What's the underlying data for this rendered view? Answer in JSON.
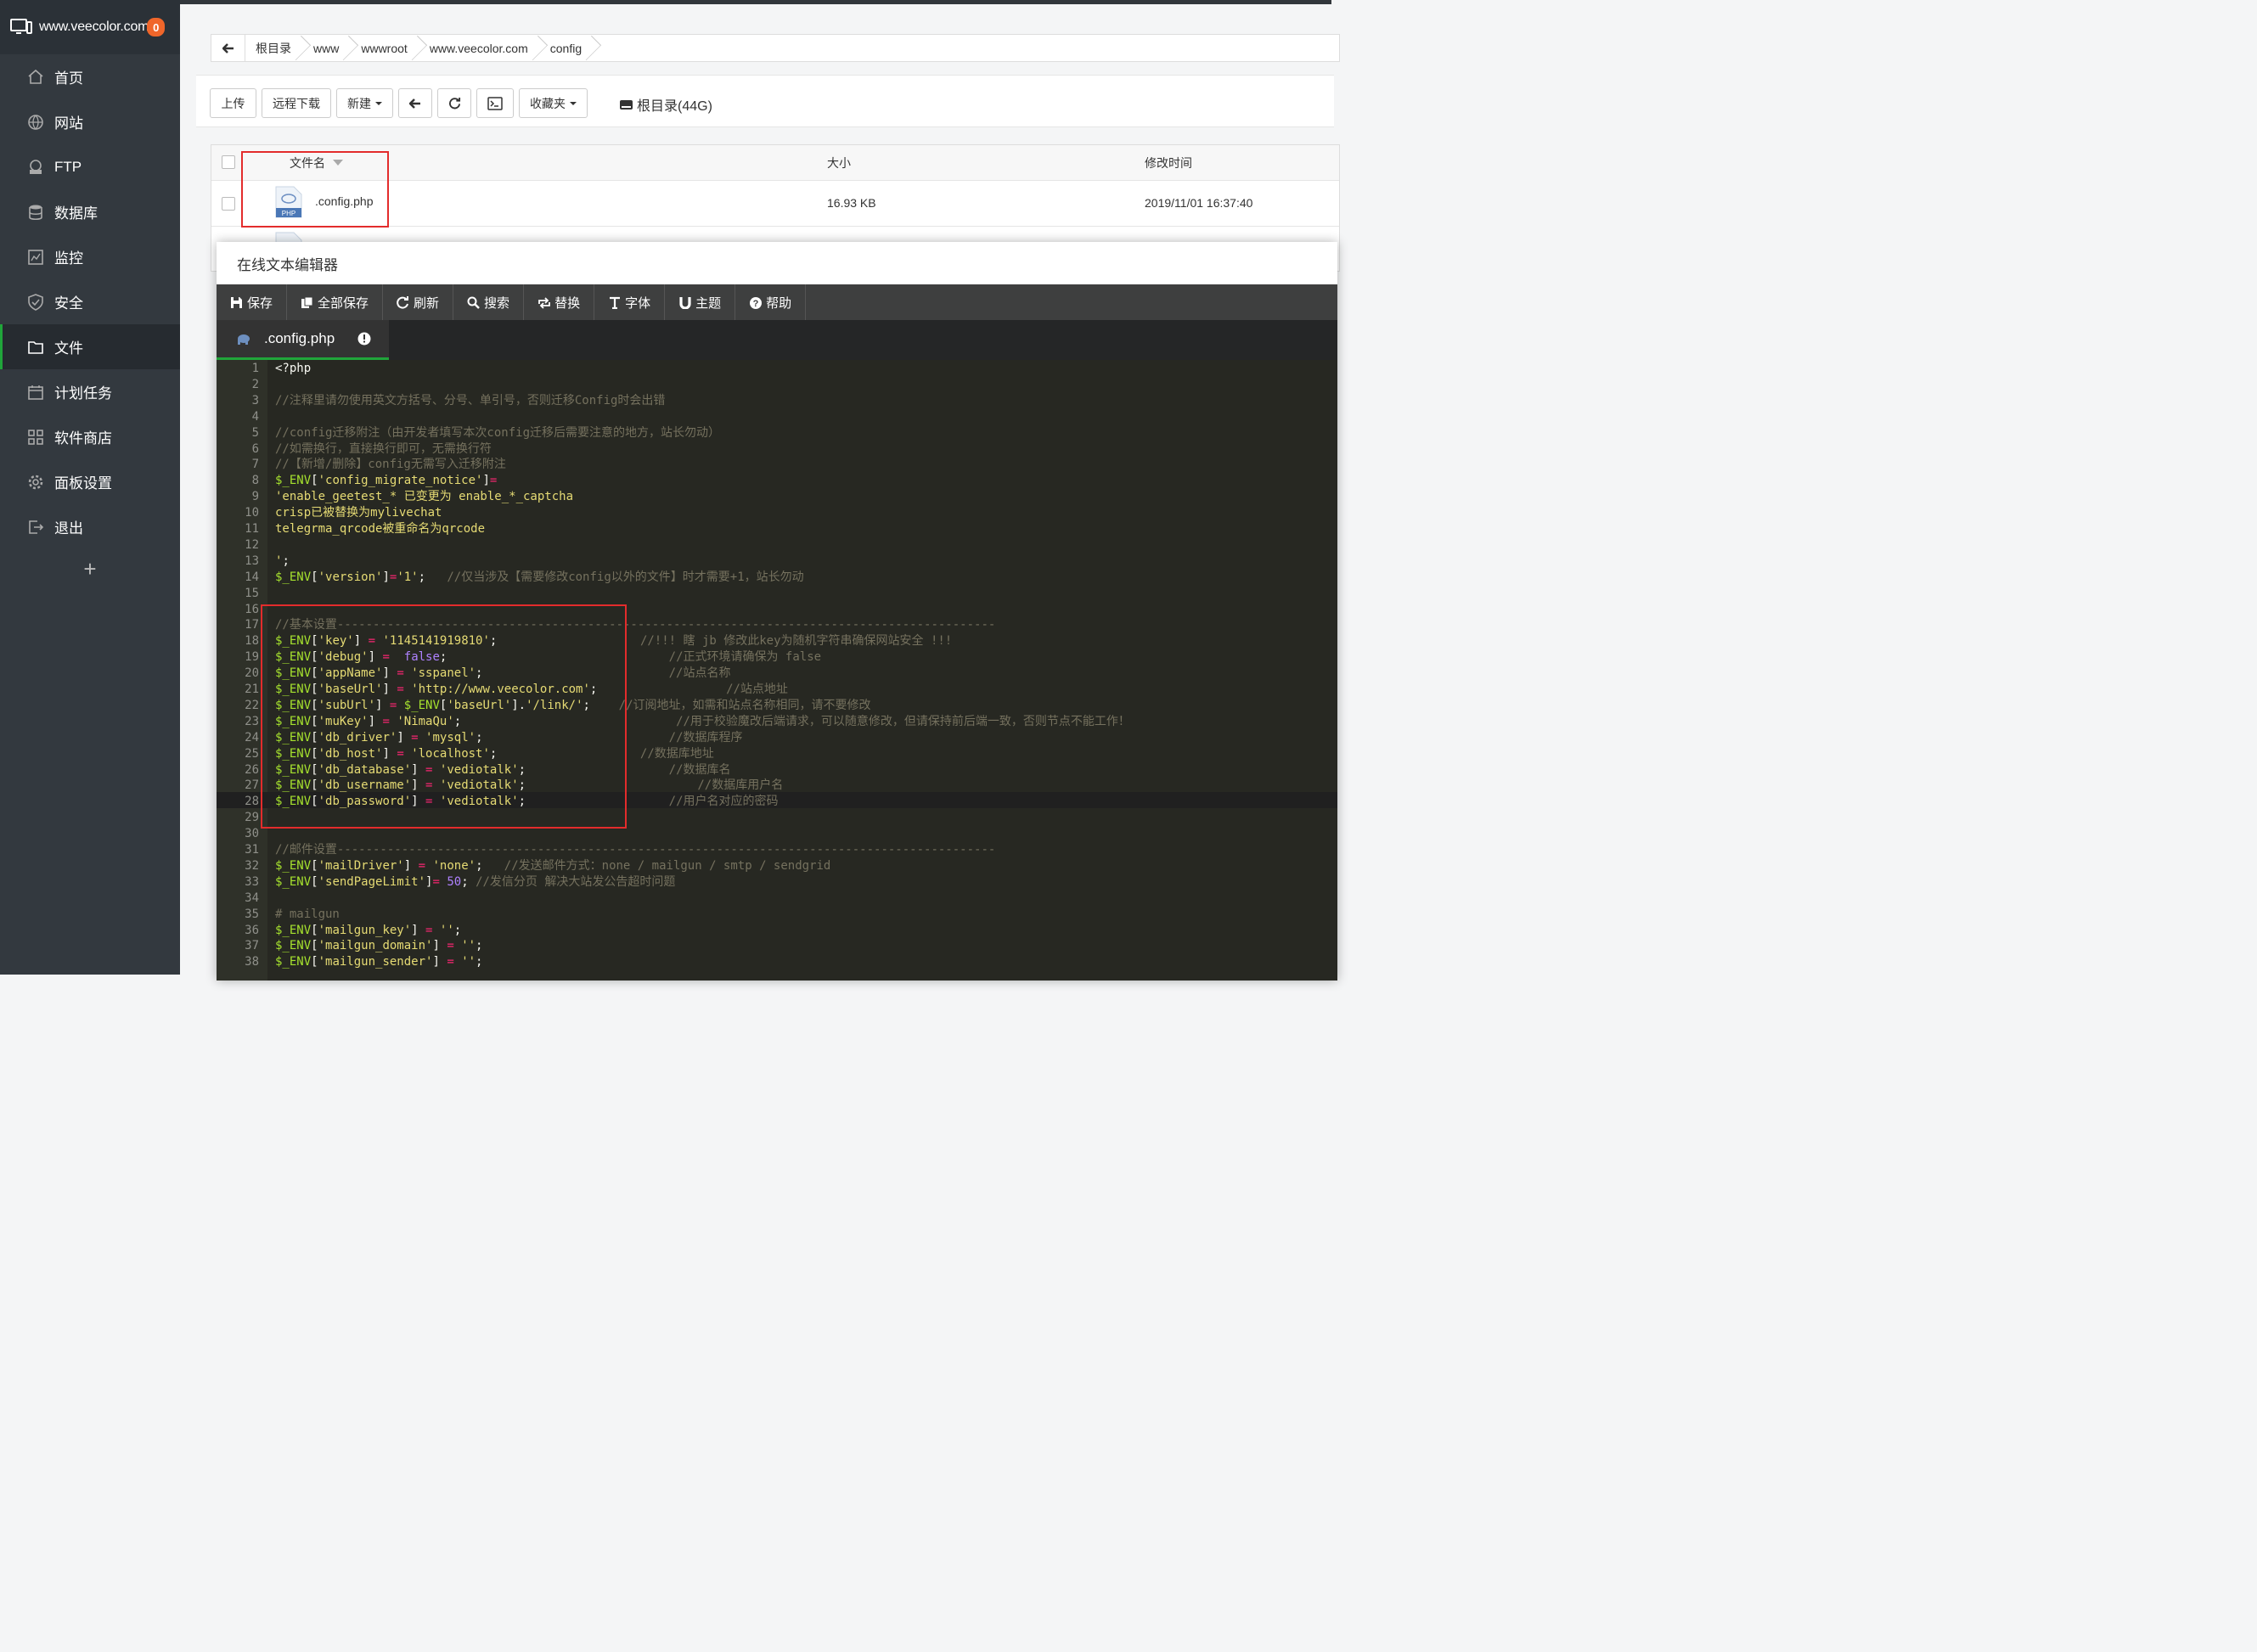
{
  "sidebar": {
    "site": "www.veecolor.com",
    "badge": "0",
    "items": [
      {
        "label": "首页",
        "icon": "home-icon"
      },
      {
        "label": "网站",
        "icon": "globe-icon"
      },
      {
        "label": "FTP",
        "icon": "ftp-icon"
      },
      {
        "label": "数据库",
        "icon": "database-icon"
      },
      {
        "label": "监控",
        "icon": "monitor-icon"
      },
      {
        "label": "安全",
        "icon": "shield-icon"
      },
      {
        "label": "文件",
        "icon": "folder-icon",
        "active": true
      },
      {
        "label": "计划任务",
        "icon": "calendar-icon"
      },
      {
        "label": "软件商店",
        "icon": "apps-icon"
      },
      {
        "label": "面板设置",
        "icon": "gear-icon"
      },
      {
        "label": "退出",
        "icon": "logout-icon"
      }
    ],
    "add": "+"
  },
  "breadcrumb": [
    "根目录",
    "www",
    "wwwroot",
    "www.veecolor.com",
    "config"
  ],
  "toolbar": {
    "upload": "上传",
    "remote_download": "远程下载",
    "new": "新建",
    "favorites": "收藏夹",
    "disk": "根目录(44G)"
  },
  "table": {
    "col_name": "文件名",
    "col_size": "大小",
    "col_mtime": "修改时间",
    "row": {
      "name": ".config.php",
      "icon_label": "PHP",
      "size": "16.93 KB",
      "mtime": "2019/11/01 16:37:40"
    }
  },
  "editor": {
    "title": "在线文本编辑器",
    "tools": [
      "保存",
      "全部保存",
      "刷新",
      "搜索",
      "替换",
      "字体",
      "主题",
      "帮助"
    ],
    "tab": ".config.php",
    "lines": [
      "<?php",
      "",
      "//注释里请勿使用英文方括号、分号、单引号，否则迁移Config时会出错",
      "",
      "//config迁移附注（由开发者填写本次config迁移后需要注意的地方，站长勿动）",
      "//如需换行，直接换行即可，无需换行符",
      "//【新增/删除】config无需写入迁移附注",
      "$_ENV['config_migrate_notice']=",
      "'enable_geetest_* 已变更为 enable_*_captcha",
      "crisp已被替换为mylivechat",
      "telegrma_qrcode被重命名为qrcode",
      "",
      "';",
      "$_ENV['version']='1';   //仅当涉及【需要修改config以外的文件】时才需要+1，站长勿动",
      "",
      "",
      "//基本设置--------------------------------------------------------------------------------------------",
      "$_ENV['key'] = '1145141919810';                    //!!! 瞎 jb 修改此key为随机字符串确保网站安全 !!!",
      "$_ENV['debug'] =  false;                               //正式环境请确保为 false",
      "$_ENV['appName'] = 'sspanel';                          //站点名称",
      "$_ENV['baseUrl'] = 'http://www.veecolor.com';                  //站点地址",
      "$_ENV['subUrl'] = $_ENV['baseUrl'].'/link/';    //订阅地址，如需和站点名称相同，请不要修改",
      "$_ENV['muKey'] = 'NimaQu';                              //用于校验魔改后端请求，可以随意修改，但请保持前后端一致，否则节点不能工作！",
      "$_ENV['db_driver'] = 'mysql';                          //数据库程序",
      "$_ENV['db_host'] = 'localhost';                    //数据库地址",
      "$_ENV['db_database'] = 'vediotalk';                    //数据库名",
      "$_ENV['db_username'] = 'vediotalk';                        //数据库用户名",
      "$_ENV['db_password'] = 'vediotalk';                    //用户名对应的密码",
      "",
      "",
      "//邮件设置--------------------------------------------------------------------------------------------",
      "$_ENV['mailDriver'] = 'none';   //发送邮件方式：none / mailgun / smtp / sendgrid",
      "$_ENV['sendPageLimit']= 50; //发信分页 解决大站发公告超时问题",
      "",
      "# mailgun",
      "$_ENV['mailgun_key'] = '';",
      "$_ENV['mailgun_domain'] = '';",
      "$_ENV['mailgun_sender'] = '';"
    ]
  },
  "colors": {
    "accent": "#20a53a",
    "highlight": "#e32c2c",
    "sidebar": "#33393f",
    "editor_bg": "#272822"
  }
}
